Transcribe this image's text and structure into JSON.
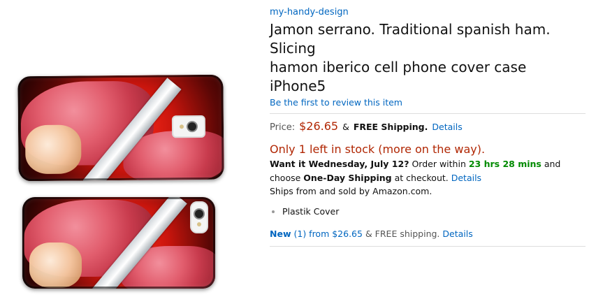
{
  "brand": "my-handy-design",
  "title_line1": "Jamon serrano. Traditional spanish ham. Slicing",
  "title_line2": "hamon iberico cell phone cover case iPhone5",
  "review_link": "Be the first to review this item",
  "price_label": "Price:",
  "price": "$26.65",
  "shipping_amp": "&",
  "shipping_text": "FREE Shipping.",
  "details_label": "Details",
  "stock_text": "Only 1 left in stock (more on the way).",
  "delivery": {
    "want_text": "Want it Wednesday, July 12?",
    "order_within": "Order within",
    "countdown": "23 hrs 28 mins",
    "and_choose": "and choose",
    "one_day": "One-Day Shipping",
    "at_checkout": "at checkout.",
    "details": "Details"
  },
  "sold_by": "Ships from and sold by Amazon.com.",
  "features": [
    "Plastik Cover"
  ],
  "offers": {
    "new_label": "New",
    "count": "(1) from $26.65",
    "shipping": "& FREE shipping.",
    "details": "Details"
  },
  "colors": {
    "link": "#0066c0",
    "price": "#B12704",
    "green": "#008a00"
  }
}
